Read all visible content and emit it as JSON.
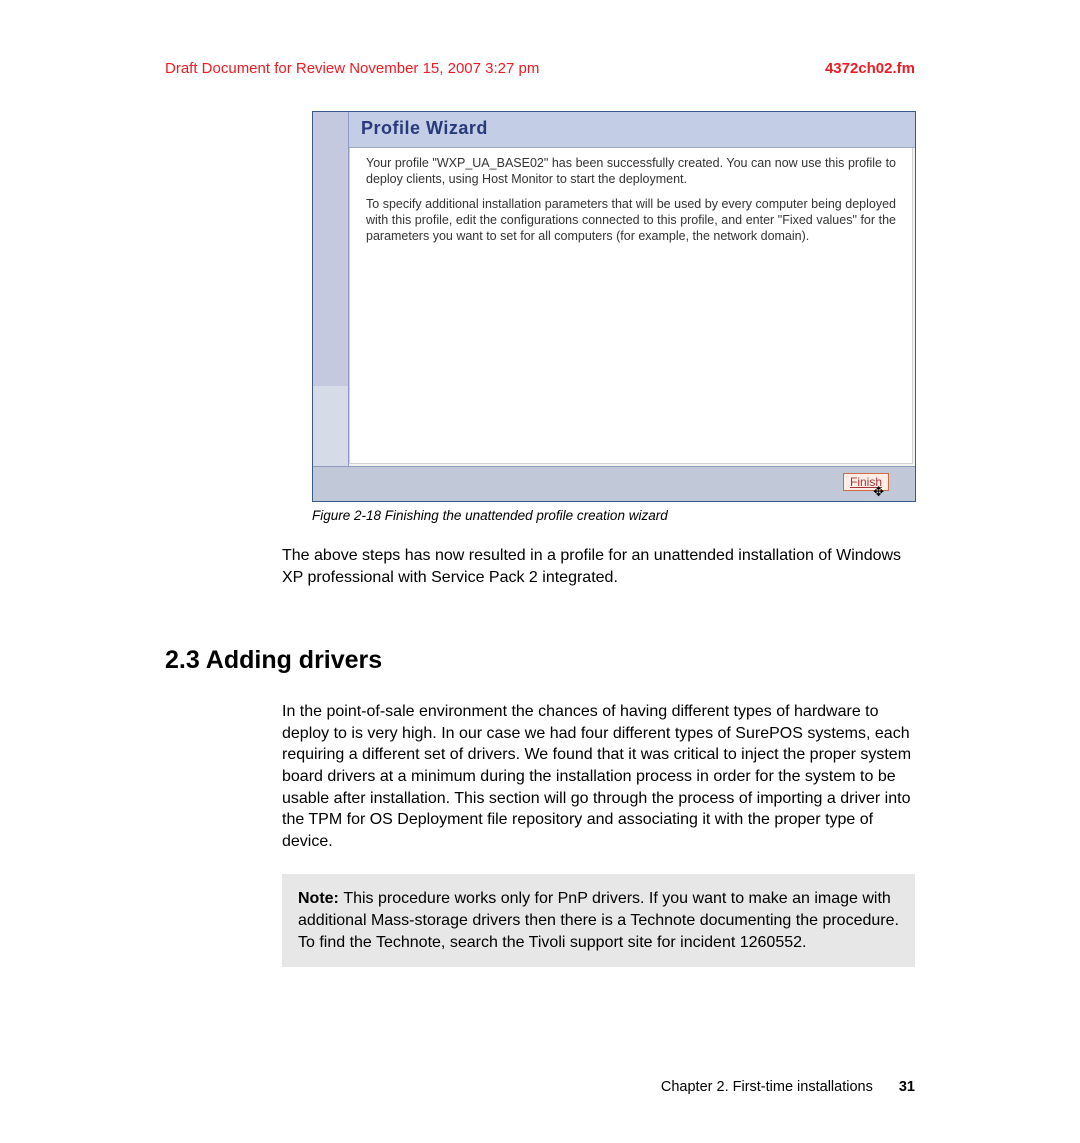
{
  "header": {
    "draft_label": "Draft Document for Review November 15, 2007 3:27 pm",
    "filename": "4372ch02.fm"
  },
  "wizard": {
    "title": "Profile Wizard",
    "para1": "Your profile \"WXP_UA_BASE02\" has been successfully created. You can now use this profile to deploy clients, using Host Monitor to start the deployment.",
    "para2": "To specify additional installation parameters that will be used by every computer being deployed with this profile, edit the configurations connected to this profile, and enter \"Fixed values\" for the parameters you want to set for all computers (for example, the network domain).",
    "finish_label": "Finish"
  },
  "figure_caption": "Figure 2-18   Finishing the unattended profile creation wizard",
  "body_para": "The above steps has now resulted in a profile for an unattended installation of Windows XP professional with Service Pack 2 integrated.",
  "section": {
    "heading": "2.3  Adding drivers",
    "para": "In the point-of-sale environment the chances of having different types of hardware to deploy to is very high. In our case we had four different types of SurePOS systems, each requiring a different set of drivers. We found that it was critical to inject the proper system board drivers at a minimum during the installation process in order for the system to be usable after installation. This section will go through the process of importing a driver into the TPM for OS Deployment file repository and associating it with the proper type of device."
  },
  "note": {
    "label": "Note: ",
    "text": "This procedure works only for PnP drivers. If you want to make an image with additional Mass-storage drivers then there is a Technote documenting the procedure. To find the Technote, search the Tivoli support site for incident 1260552."
  },
  "footer": {
    "chapter": "Chapter 2. First-time installations",
    "page": "31"
  }
}
